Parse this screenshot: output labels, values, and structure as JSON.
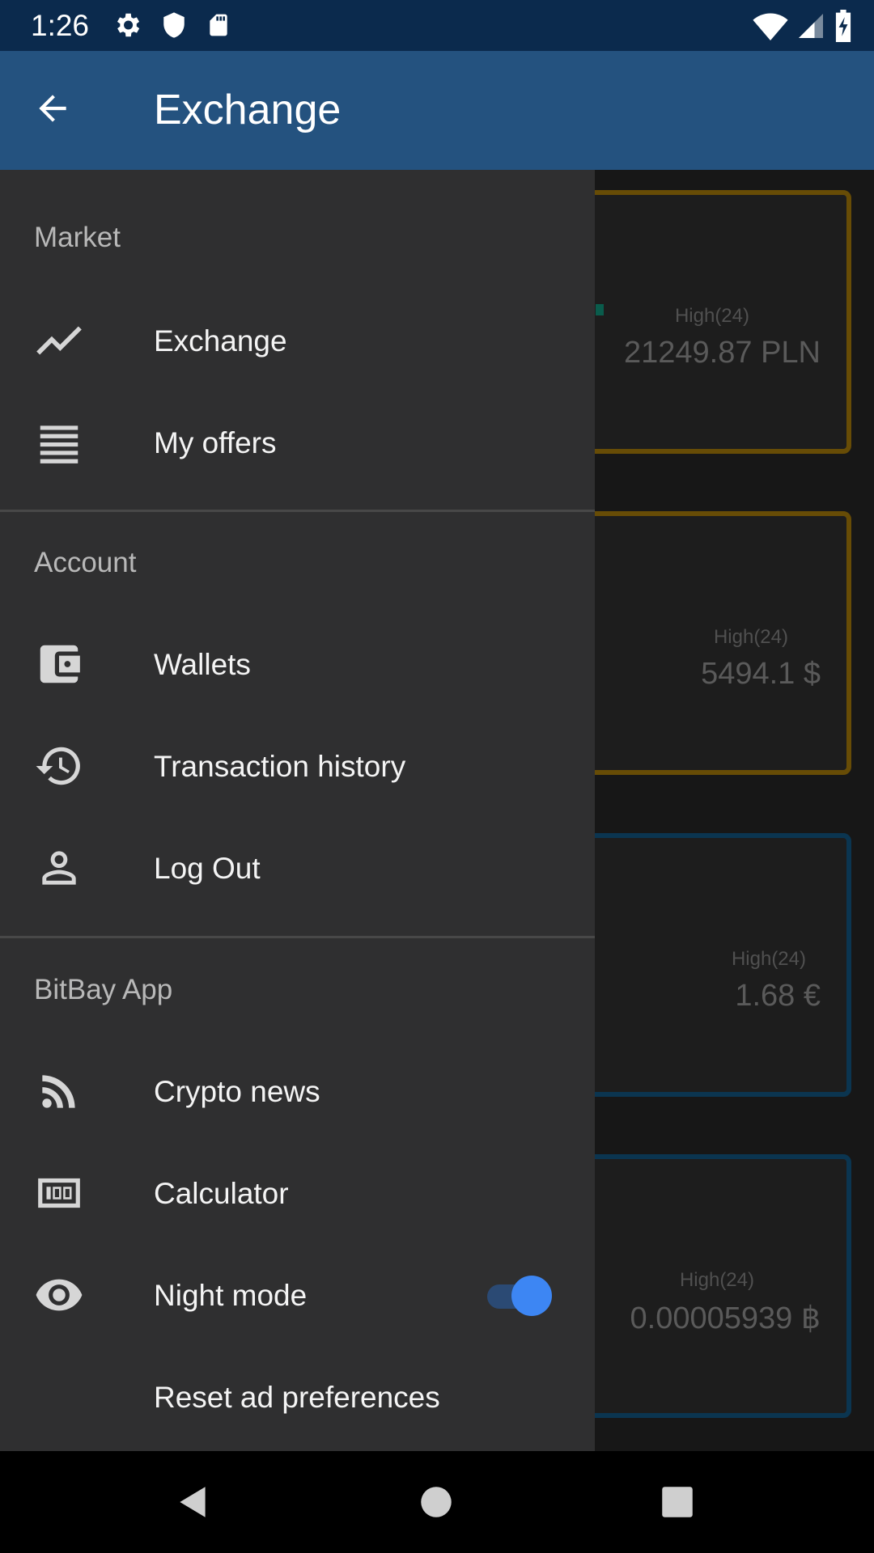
{
  "status_bar": {
    "time": "1:26",
    "icons_left": [
      "gear-icon",
      "shield-icon",
      "sd-card-icon"
    ],
    "icons_right": [
      "wifi-icon",
      "signal-icon",
      "battery-icon"
    ]
  },
  "app_bar": {
    "title": "Exchange",
    "back_icon": "arrow-back-icon"
  },
  "background_cards": [
    {
      "label": "High(24)",
      "value": "21249.87 PLN",
      "accent": "#7a5a08"
    },
    {
      "label": "High(24)",
      "value": "5494.1 $",
      "accent": "#7a5a08"
    },
    {
      "label": "High(24)",
      "value": "1.68 €",
      "accent": "#0e3f5f"
    },
    {
      "label": "High(24)",
      "value": "0.00005939 ฿",
      "accent": "#0e3f5f"
    }
  ],
  "drawer": {
    "sections": {
      "market": "Market",
      "account": "Account",
      "app": "BitBay App"
    },
    "items": {
      "exchange": {
        "label": "Exchange",
        "icon": "trending-up-icon"
      },
      "my_offers": {
        "label": "My offers",
        "icon": "list-icon"
      },
      "wallets": {
        "label": "Wallets",
        "icon": "wallet-icon"
      },
      "transaction_history": {
        "label": "Transaction history",
        "icon": "history-icon"
      },
      "log_out": {
        "label": "Log Out",
        "icon": "person-icon"
      },
      "crypto_news": {
        "label": "Crypto news",
        "icon": "rss-icon"
      },
      "calculator": {
        "label": "Calculator",
        "icon": "calculator-icon"
      },
      "night_mode": {
        "label": "Night mode",
        "icon": "eye-icon",
        "enabled": true
      },
      "reset_ad_preferences": {
        "label": "Reset ad preferences"
      }
    }
  },
  "colors": {
    "status_bar": "#0b2a4d",
    "app_bar": "#24527f",
    "drawer": "#2f2f30",
    "toggle_accent": "#3d86f3"
  }
}
